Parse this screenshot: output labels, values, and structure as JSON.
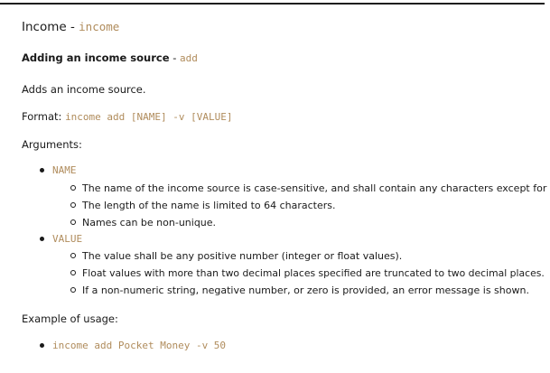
{
  "heading": {
    "title": "Income",
    "separator": " - ",
    "command": "income"
  },
  "subheading": {
    "title": "Adding an income source",
    "separator": " - ",
    "command": "add"
  },
  "description": "Adds an income source.",
  "format": {
    "label": "Format: ",
    "syntax": "income add [NAME] -v [VALUE]"
  },
  "arguments_label": "Arguments:",
  "arguments": [
    {
      "name": "NAME",
      "notes": [
        "The name of the income source is case-sensitive, and shall contain any characters except for \"-\".",
        "The length of the name is limited to 64 characters.",
        "Names can be non-unique."
      ]
    },
    {
      "name": "VALUE",
      "notes": [
        "The value shall be any positive number (integer or float values).",
        "Float values with more than two decimal places specified are truncated to two decimal places.",
        "If a non-numeric string, negative number, or zero is provided, an error message is shown."
      ]
    }
  ],
  "example_label": "Example of usage:",
  "example": "income add Pocket Money -v 50"
}
